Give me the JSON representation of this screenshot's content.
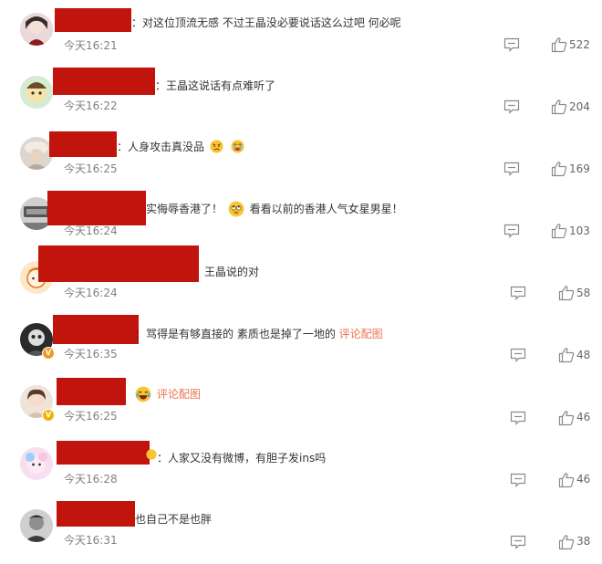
{
  "colors": {
    "redaction": "#c0140c",
    "link": "#eb7350",
    "time": "#808080",
    "icon": "#8a8a8a"
  },
  "comments": [
    {
      "text": "：对这位顶流无感 不过王晶没必要说话这么过吧 何必呢",
      "time": "今天16:21",
      "likes": "522"
    },
    {
      "text": "：王晶这说话有点难听了",
      "time": "今天16:22",
      "likes": "204"
    },
    {
      "text": "：人身攻击真没品",
      "time": "今天16:25",
      "likes": "169",
      "emojis": [
        "angry-face",
        "crying-face"
      ]
    },
    {
      "text": "实侮辱香港了！",
      "text2": "看看以前的香港人气女星男星！",
      "time": "今天16:24",
      "likes": "103",
      "emojis": [
        "eye-roll-face"
      ]
    },
    {
      "text": "王晶说的对",
      "time": "今天16:24",
      "likes": "58"
    },
    {
      "text": "：骂得是有够直接的 素质也是掉了一地的",
      "link": "评论配图",
      "time": "今天16:35",
      "likes": "48"
    },
    {
      "text": "",
      "link": "评论配图",
      "time": "今天16:25",
      "likes": "46",
      "emojis": [
        "laughing-tears-face"
      ]
    },
    {
      "text": "：人家又没有微博，有胆子发ins吗",
      "time": "今天16:28",
      "likes": "46"
    },
    {
      "text": "也自己不是也胖",
      "time": "今天16:31",
      "likes": "38"
    }
  ]
}
